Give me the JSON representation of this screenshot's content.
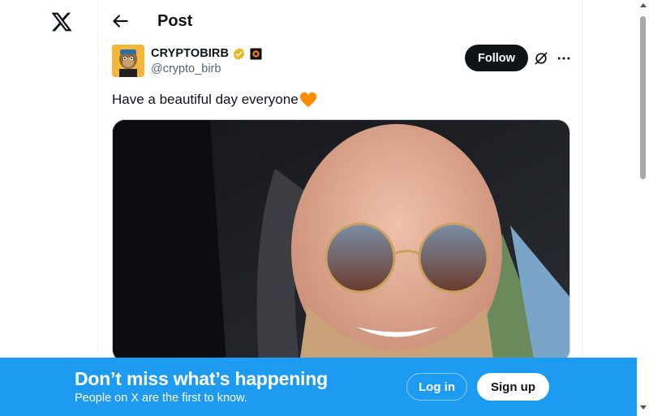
{
  "nav": {
    "logo_icon": "x-logo-icon"
  },
  "header": {
    "back_icon": "arrow-left-icon",
    "title": "Post"
  },
  "post": {
    "author": {
      "display_name": "CRYPTOBIRB",
      "handle": "@crypto_birb",
      "verified_icon": "gold-verified-badge-icon",
      "affiliation_icon": "affiliate-badge-icon",
      "avatar_icon": "ape-avatar"
    },
    "follow_label": "Follow",
    "grok_icon": "grok-icon",
    "more_icon": "more-options-icon",
    "text": "Have a beautiful day everyone",
    "emoji": "orange-heart-emoji",
    "media_description": "photo"
  },
  "banner": {
    "title": "Don’t miss what’s happening",
    "subtitle": "People on X are the first to know.",
    "login_label": "Log in",
    "signup_label": "Sign up"
  },
  "colors": {
    "accent": "#1d9bf0",
    "text_primary": "#0f1419",
    "text_secondary": "#536471",
    "verified_gold": "#e2b719",
    "heart": "#ff8c00"
  }
}
